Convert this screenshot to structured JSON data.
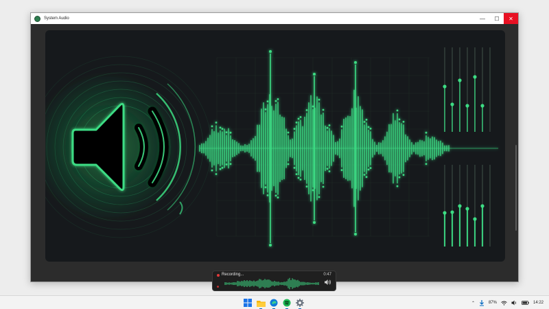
{
  "window": {
    "title": "System Audio",
    "controls": {
      "minimize": "—",
      "maximize": "☐",
      "close": "✕"
    }
  },
  "recording": {
    "status": "Recording...",
    "elapsed": "0:47",
    "secondary": "• • •"
  },
  "taskbar": {
    "apps": [
      "windows-start",
      "file-explorer",
      "edge-browser",
      "spotify",
      "settings"
    ],
    "tray": {
      "battery_percent": "87%",
      "time": "14:22"
    }
  },
  "colors": {
    "accent_green": "#3ddc84",
    "glow_green": "#22c55e",
    "panel_bg": "#16191c",
    "record_red": "#e23a3a"
  }
}
